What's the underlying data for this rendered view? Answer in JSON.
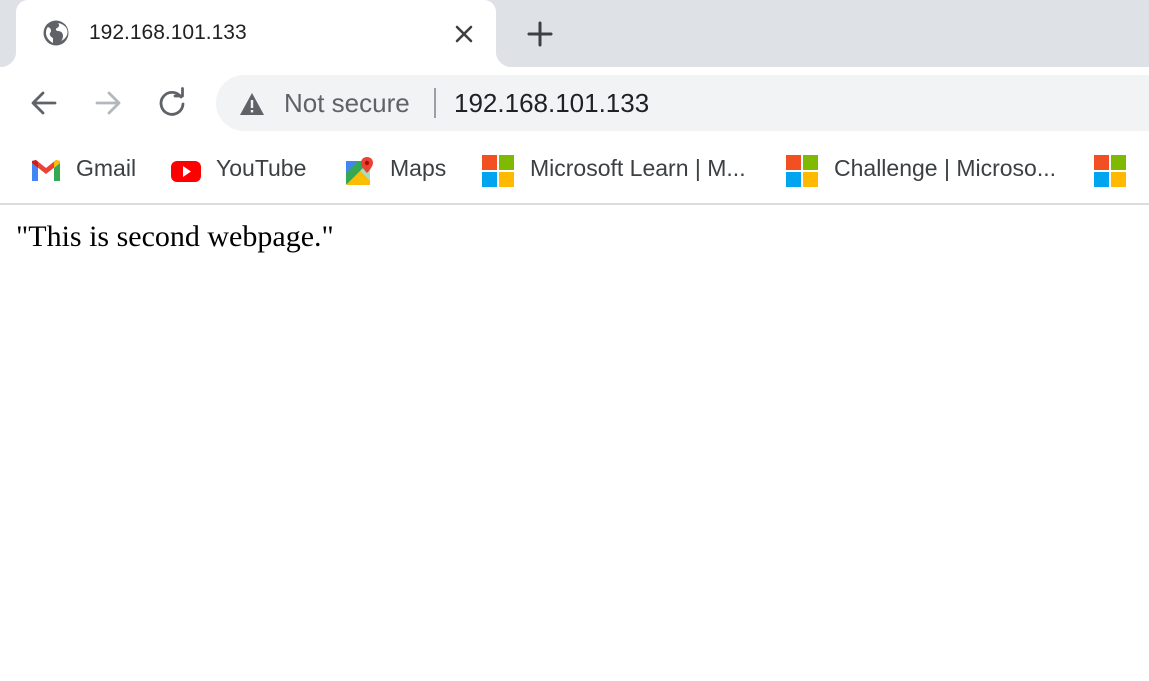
{
  "tab": {
    "icon": "globe-icon",
    "title": "192.168.101.133",
    "close_icon": "close-icon"
  },
  "new_tab_icon": "plus-icon",
  "toolbar": {
    "back_icon": "arrow-left-icon",
    "forward_icon": "arrow-right-icon",
    "reload_icon": "reload-icon"
  },
  "omnibox": {
    "security_icon": "warning-triangle-icon",
    "security_label": "Not secure",
    "url": "192.168.101.133"
  },
  "bookmarks": [
    {
      "label": "Gmail",
      "icon": "gmail-icon"
    },
    {
      "label": "YouTube",
      "icon": "youtube-icon"
    },
    {
      "label": "Maps",
      "icon": "maps-icon"
    },
    {
      "label": "Microsoft Learn | M...",
      "icon": "microsoft-icon"
    },
    {
      "label": "Challenge | Microso...",
      "icon": "microsoft-icon"
    },
    {
      "label": "",
      "icon": "microsoft-icon"
    }
  ],
  "page": {
    "text": "\"This is second webpage.\""
  },
  "colors": {
    "tabstrip": "#dee1e6",
    "omnibox": "#f1f3f4",
    "text": "#202124"
  }
}
